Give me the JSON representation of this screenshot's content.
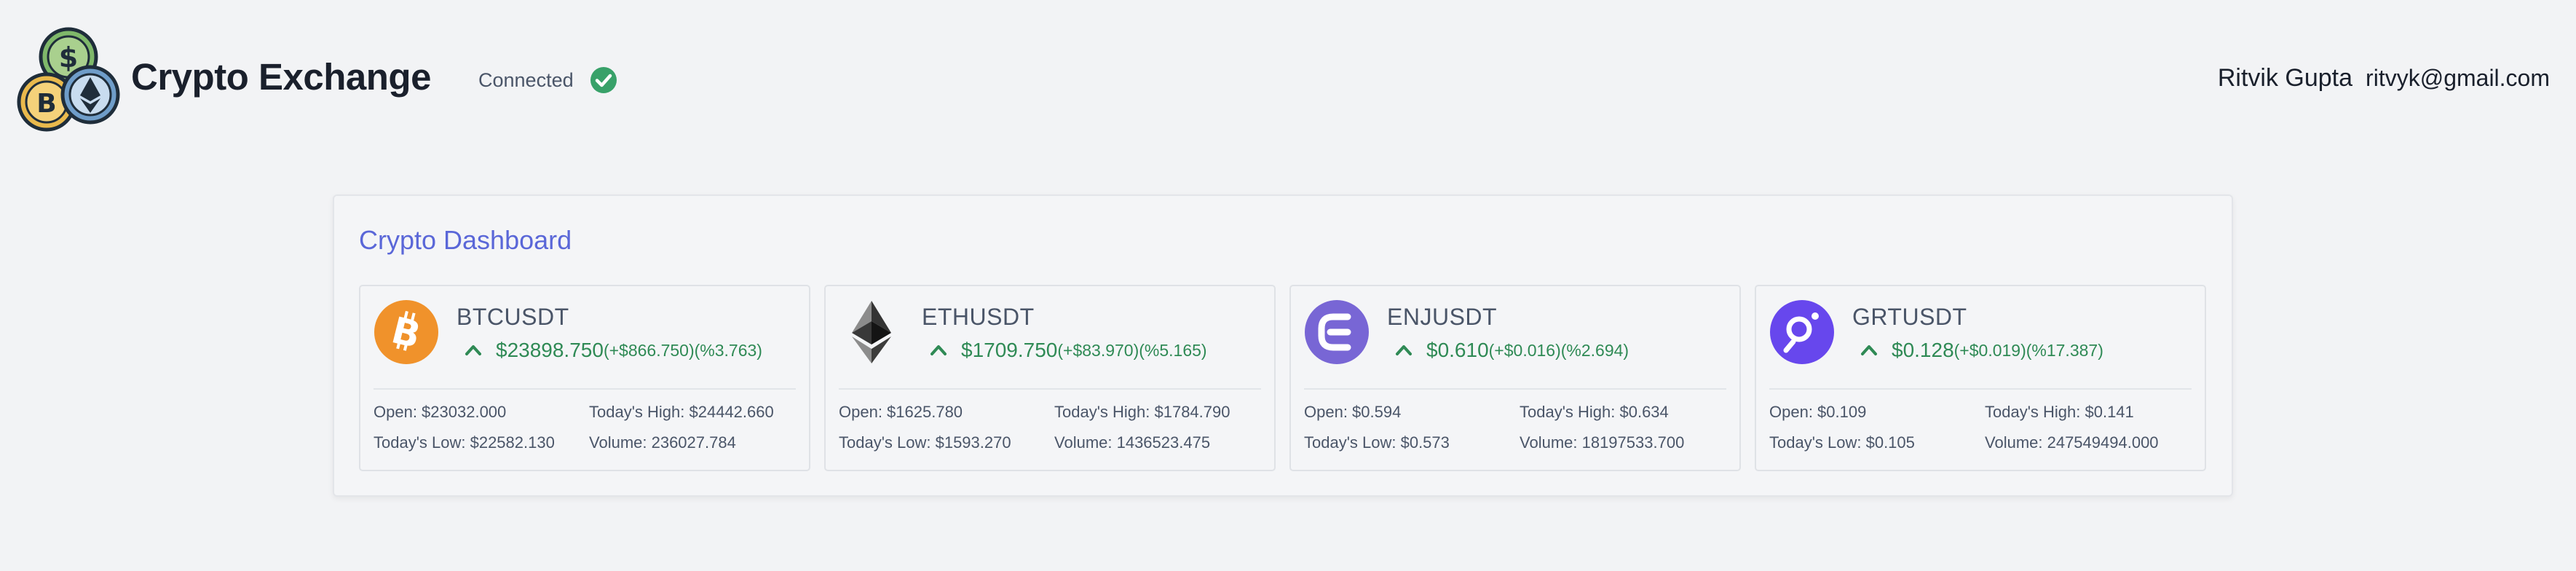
{
  "header": {
    "title": "Crypto Exchange",
    "status": "Connected",
    "user_name": "Ritvik Gupta",
    "user_email": "ritvyk@gmail.com"
  },
  "dashboard": {
    "title": "Crypto Dashboard",
    "cards": [
      {
        "symbol": "BTCUSDT",
        "icon": "bitcoin-icon",
        "price": "$23898.750",
        "change": "(+$866.750)(%3.763)",
        "open": "Open: $23032.000",
        "high": "Today's High: $24442.660",
        "low": "Today's Low: $22582.130",
        "volume": "Volume: 236027.784"
      },
      {
        "symbol": "ETHUSDT",
        "icon": "ethereum-icon",
        "price": "$1709.750",
        "change": "(+$83.970)(%5.165)",
        "open": "Open: $1625.780",
        "high": "Today's High: $1784.790",
        "low": "Today's Low: $1593.270",
        "volume": "Volume: 1436523.475"
      },
      {
        "symbol": "ENJUSDT",
        "icon": "enjin-icon",
        "price": "$0.610",
        "change": "(+$0.016)(%2.694)",
        "open": "Open: $0.594",
        "high": "Today's High: $0.634",
        "low": "Today's Low: $0.573",
        "volume": "Volume: 18197533.700"
      },
      {
        "symbol": "GRTUSDT",
        "icon": "the-graph-icon",
        "price": "$0.128",
        "change": "(+$0.019)(%17.387)",
        "open": "Open: $0.109",
        "high": "Today's High: $0.141",
        "low": "Today's Low: $0.105",
        "volume": "Volume: 247549494.000"
      }
    ]
  },
  "colors": {
    "accent": "#5a67d8",
    "positive": "#2f8a55",
    "bitcoin": "#f0922b",
    "enjin": "#7866d5",
    "graph": "#6747ed",
    "status_ok": "#38a169"
  }
}
